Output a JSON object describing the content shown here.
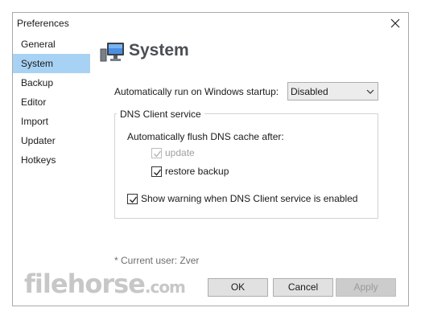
{
  "window": {
    "title": "Preferences"
  },
  "sidebar": {
    "items": [
      {
        "label": "General"
      },
      {
        "label": "System"
      },
      {
        "label": "Backup"
      },
      {
        "label": "Editor"
      },
      {
        "label": "Import"
      },
      {
        "label": "Updater"
      },
      {
        "label": "Hotkeys"
      }
    ],
    "selected": "System",
    "selected_color": "#a8d2f4"
  },
  "page": {
    "title": "System",
    "icon": "computer-monitor-icon"
  },
  "startup": {
    "label": "Automatically run on Windows startup:",
    "selected_value": "Disabled"
  },
  "dns_group": {
    "legend": "DNS Client service",
    "flush_label": "Automatically flush DNS cache after:",
    "update": {
      "label": "update",
      "checked": true,
      "enabled": false
    },
    "restore_backup": {
      "label": "restore backup",
      "checked": true,
      "enabled": true
    },
    "show_warning": {
      "label": "Show warning when DNS Client service is enabled",
      "checked": true,
      "enabled": true
    }
  },
  "footer": {
    "current_user": "* Current user: Zver"
  },
  "buttons": {
    "ok": "OK",
    "cancel": "Cancel",
    "apply": "Apply"
  },
  "watermark": {
    "text": "filehorse",
    "suffix": ".com"
  }
}
